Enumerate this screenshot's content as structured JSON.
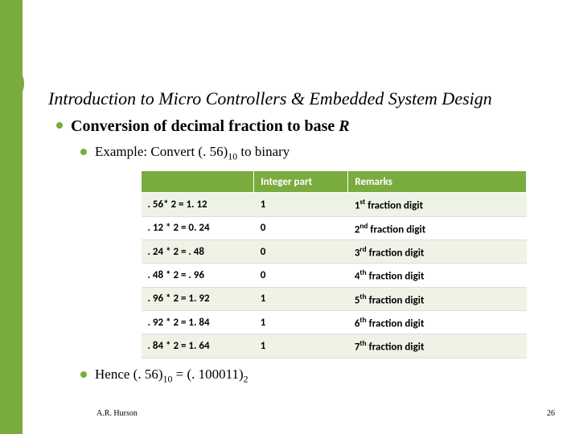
{
  "title": "Introduction to Micro Controllers & Embedded System Design",
  "heading": {
    "prefix": "Conversion of decimal fraction to base ",
    "var": "R"
  },
  "example": {
    "label": "Example:  Convert (. 56)",
    "sub1": "10",
    "tail": " to binary"
  },
  "table": {
    "headers": {
      "blank": "",
      "int": "Integer part",
      "rem": "Remarks"
    },
    "rows": [
      {
        "calc": ". 56* 2 = 1. 12",
        "int": "1",
        "ord": "1",
        "suf": "st",
        "tail": " fraction digit"
      },
      {
        "calc": ". 12 * 2 = 0. 24",
        "int": "0",
        "ord": "2",
        "suf": "nd",
        "tail": " fraction digit"
      },
      {
        "calc": ". 24 * 2 = . 48",
        "int": "0",
        "ord": "3",
        "suf": "rd",
        "tail": " fraction digit"
      },
      {
        "calc": ". 48 * 2 = . 96",
        "int": "0",
        "ord": "4",
        "suf": "th",
        "tail": " fraction digit"
      },
      {
        "calc": ". 96 * 2 = 1. 92",
        "int": "1",
        "ord": "5",
        "suf": "th",
        "tail": " fraction digit"
      },
      {
        "calc": ". 92 * 2 = 1. 84",
        "int": "1",
        "ord": "6",
        "suf": "th",
        "tail": " fraction digit"
      },
      {
        "calc": ". 84 * 2 = 1. 64",
        "int": "1",
        "ord": "7",
        "suf": "th",
        "tail": " fraction digit"
      }
    ]
  },
  "hence": {
    "a": "Hence (. 56)",
    "sub1": "10",
    "b": " = (. 100011)",
    "sub2": "2"
  },
  "footer": {
    "author": "A.R. Hurson",
    "page": "26"
  }
}
